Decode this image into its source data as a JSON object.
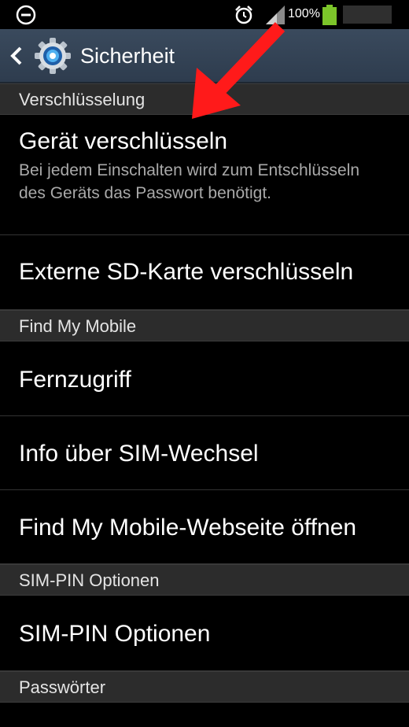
{
  "status_bar": {
    "battery_percent": "100%",
    "icons": [
      "do-not-disturb-icon",
      "alarm-icon",
      "signal-icon",
      "battery-icon"
    ],
    "battery_color": "#7cc52a"
  },
  "action_bar": {
    "title": "Sicherheit",
    "icons": [
      "back-icon",
      "settings-icon"
    ]
  },
  "sections": [
    {
      "header": "Verschlüsselung",
      "items": [
        {
          "title": "Gerät verschlüsseln",
          "summary": "Bei jedem Einschalten wird zum Entschlüsseln des Geräts das Passwort benötigt."
        },
        {
          "title": "Externe SD-Karte verschlüsseln"
        }
      ]
    },
    {
      "header": "Find My Mobile",
      "items": [
        {
          "title": "Fernzugriff"
        },
        {
          "title": "Info über SIM-Wechsel"
        },
        {
          "title": "Find My Mobile-Webseite öffnen"
        }
      ]
    },
    {
      "header": "SIM-PIN Optionen",
      "items": [
        {
          "title": "SIM-PIN Optionen"
        }
      ]
    },
    {
      "header": "Passwörter",
      "items": []
    }
  ],
  "annotation": {
    "arrow_color": "#ff1a1a"
  }
}
